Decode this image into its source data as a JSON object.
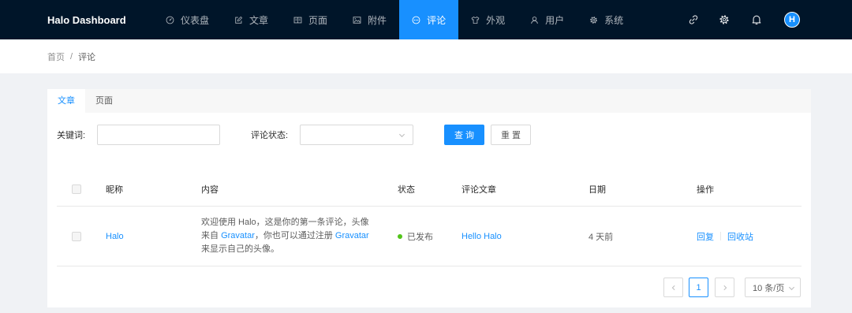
{
  "colors": {
    "nav_bg": "#001529",
    "primary": "#1890ff",
    "page_bg": "#f0f2f5",
    "status_published": "#52c41a"
  },
  "nav": {
    "brand": "Halo Dashboard",
    "items": [
      {
        "label": "仪表盘",
        "icon": "dashboard-icon",
        "active": false
      },
      {
        "label": "文章",
        "icon": "edit-icon",
        "active": false
      },
      {
        "label": "页面",
        "icon": "read-icon",
        "active": false
      },
      {
        "label": "附件",
        "icon": "picture-icon",
        "active": false
      },
      {
        "label": "评论",
        "icon": "message-icon",
        "active": true
      },
      {
        "label": "外观",
        "icon": "skin-icon",
        "active": false
      },
      {
        "label": "用户",
        "icon": "user-icon",
        "active": false
      },
      {
        "label": "系统",
        "icon": "setting-icon",
        "active": false
      }
    ],
    "right_icons": [
      "link-icon",
      "setting-icon",
      "bell-icon"
    ],
    "avatar_initial": "H"
  },
  "breadcrumb": {
    "items": [
      "首页",
      "评论"
    ],
    "separator": "/"
  },
  "tabs": [
    {
      "label": "文章",
      "active": true
    },
    {
      "label": "页面",
      "active": false
    }
  ],
  "filters": {
    "keyword": {
      "label": "关键词:",
      "value": ""
    },
    "status": {
      "label": "评论状态:",
      "value": ""
    },
    "search_button": "查 询",
    "reset_button": "重 置"
  },
  "table": {
    "columns": [
      "昵称",
      "内容",
      "状态",
      "评论文章",
      "日期",
      "操作"
    ],
    "rows": [
      {
        "author": "Halo",
        "content": [
          {
            "text": "欢迎使用 Halo，这是你的第一条评论，头像",
            "link": false
          },
          {
            "text": "来自 ",
            "link": false
          },
          {
            "text": "Gravatar",
            "link": true
          },
          {
            "text": "，你也可以通过注册 ",
            "link": false
          },
          {
            "text": "Gravatar",
            "link": true
          },
          {
            "text": "来显示自己的头像。",
            "link": false
          }
        ],
        "status": "已发布",
        "post": "Hello Halo",
        "date": "4 天前",
        "actions": [
          "回复",
          "回收站"
        ]
      }
    ]
  },
  "pagination": {
    "current": "1",
    "page_size": "10 条/页"
  }
}
